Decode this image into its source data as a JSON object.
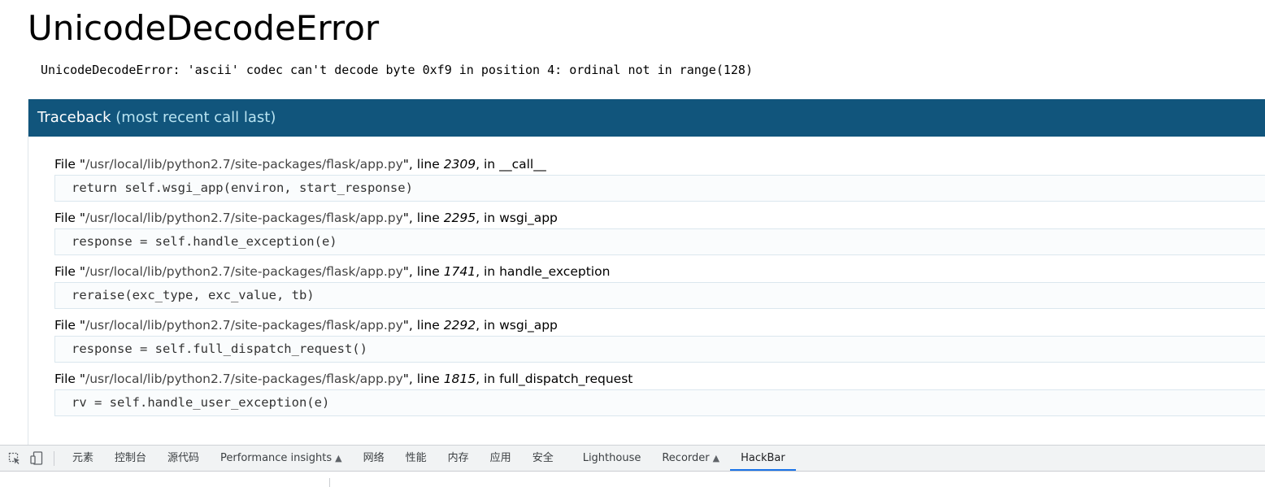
{
  "error": {
    "title": "UnicodeDecodeError",
    "message": "UnicodeDecodeError: 'ascii' codec can't decode byte 0xf9 in position 4: ordinal not in range(128)"
  },
  "traceback": {
    "header": "Traceback",
    "header_note": "(most recent call last)",
    "frames": [
      {
        "prefix": "File \"",
        "file": "/usr/local/lib/python2.7/site-packages/flask/app.py",
        "mid": "\", line ",
        "line": "2309",
        "in": ", in ",
        "func": "__call__",
        "code": "return self.wsgi_app(environ, start_response)"
      },
      {
        "prefix": "File \"",
        "file": "/usr/local/lib/python2.7/site-packages/flask/app.py",
        "mid": "\", line ",
        "line": "2295",
        "in": ", in ",
        "func": "wsgi_app",
        "code": "response = self.handle_exception(e)"
      },
      {
        "prefix": "File \"",
        "file": "/usr/local/lib/python2.7/site-packages/flask/app.py",
        "mid": "\", line ",
        "line": "1741",
        "in": ", in ",
        "func": "handle_exception",
        "code": "reraise(exc_type, exc_value, tb)"
      },
      {
        "prefix": "File \"",
        "file": "/usr/local/lib/python2.7/site-packages/flask/app.py",
        "mid": "\", line ",
        "line": "2292",
        "in": ", in ",
        "func": "wsgi_app",
        "code": "response = self.full_dispatch_request()"
      },
      {
        "prefix": "File \"",
        "file": "/usr/local/lib/python2.7/site-packages/flask/app.py",
        "mid": "\", line ",
        "line": "1815",
        "in": ", in ",
        "func": "full_dispatch_request",
        "code": "rv = self.handle_user_exception(e)"
      }
    ]
  },
  "devtools": {
    "icons": [
      "inspect-element-icon",
      "device-toggle-icon"
    ],
    "tabs": [
      {
        "label": "元素",
        "experimental": false,
        "active": false
      },
      {
        "label": "控制台",
        "experimental": false,
        "active": false
      },
      {
        "label": "源代码",
        "experimental": false,
        "active": false
      },
      {
        "label": "Performance insights",
        "experimental": true,
        "active": false
      },
      {
        "label": "网络",
        "experimental": false,
        "active": false
      },
      {
        "label": "性能",
        "experimental": false,
        "active": false
      },
      {
        "label": "内存",
        "experimental": false,
        "active": false
      },
      {
        "label": "应用",
        "experimental": false,
        "active": false
      },
      {
        "label": "安全",
        "experimental": false,
        "active": false
      },
      {
        "label": "Lighthouse",
        "experimental": false,
        "active": false
      },
      {
        "label": "Recorder",
        "experimental": true,
        "active": false
      },
      {
        "label": "HackBar",
        "experimental": false,
        "active": true
      }
    ],
    "experimental_icon": "flask-icon",
    "accent_color": "#1a73e8"
  },
  "colors": {
    "traceback_header_bg": "#11557c",
    "traceback_header_note": "#b8e3f1"
  }
}
